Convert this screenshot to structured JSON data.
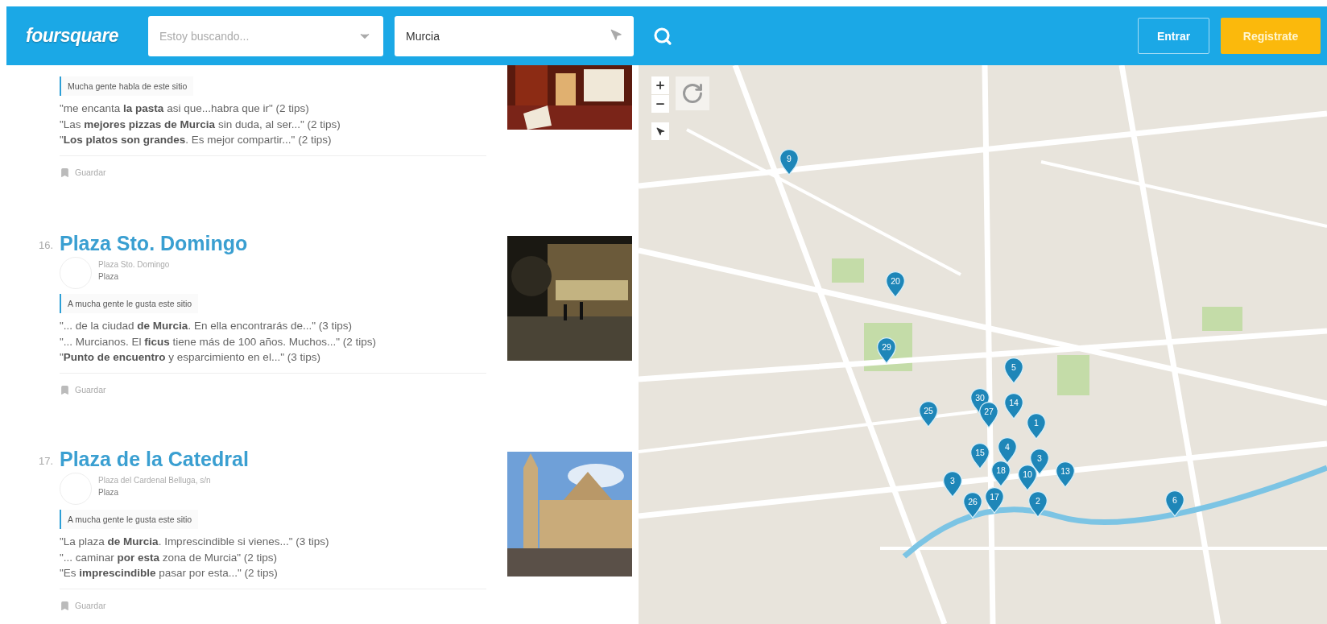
{
  "header": {
    "logo": "foursquare",
    "search": {
      "placeholder": "Estoy buscando..."
    },
    "location": {
      "value": "Murcia"
    },
    "buttons": [
      {
        "kind": "outline",
        "label": "Entrar"
      },
      {
        "kind": "primary",
        "label": "Registrate"
      }
    ]
  },
  "venues": [
    {
      "tag": "Mucha gente habla de este sitio",
      "tips": [
        "\"me encanta **la pasta** asi que...habra que ir\" (2 tips)",
        "\"Las **mejores pizzas de Murcia** sin duda, al ser...\" (2 tips)",
        "\"**Los platos son grandes**. Es mejor compartir...\" (2 tips)"
      ],
      "save": "Guardar"
    },
    {
      "number": "16.",
      "name": "Plaza Sto. Domingo",
      "address": "Plaza Sto. Domingo",
      "category": "Plaza",
      "tag": "A mucha gente le gusta este sitio",
      "tips": [
        "\"... de la ciudad **de Murcia**. En ella encontrarás de...\" (3 tips)",
        "\"... Murcianos. El **ficus** tiene más de 100 años. Muchos...\" (2 tips)",
        "\"**Punto de encuentro** y esparcimiento en el...\" (3 tips)"
      ],
      "save": "Guardar"
    },
    {
      "number": "17.",
      "name": "Plaza de la Catedral",
      "address": "Plaza del Cardenal Belluga, s/n",
      "category": "Plaza",
      "tag": "A mucha gente le gusta este sitio",
      "tips": [
        "\"La plaza **de Murcia**. Imprescindible si vienes...\" (3 tips)",
        "\"... caminar **por esta** zona de Murcia\" (2 tips)",
        "\"Es **imprescindible** pasar por esta...\" (2 tips)"
      ],
      "save": "Guardar"
    }
  ],
  "map": {
    "kind": "picture",
    "pins": [
      "9",
      "20",
      "29",
      "5",
      "30",
      "27",
      "14",
      "25",
      "1",
      "15",
      "4",
      "3",
      "18",
      "10",
      "13",
      "3",
      "26",
      "17",
      "2",
      "6"
    ]
  }
}
